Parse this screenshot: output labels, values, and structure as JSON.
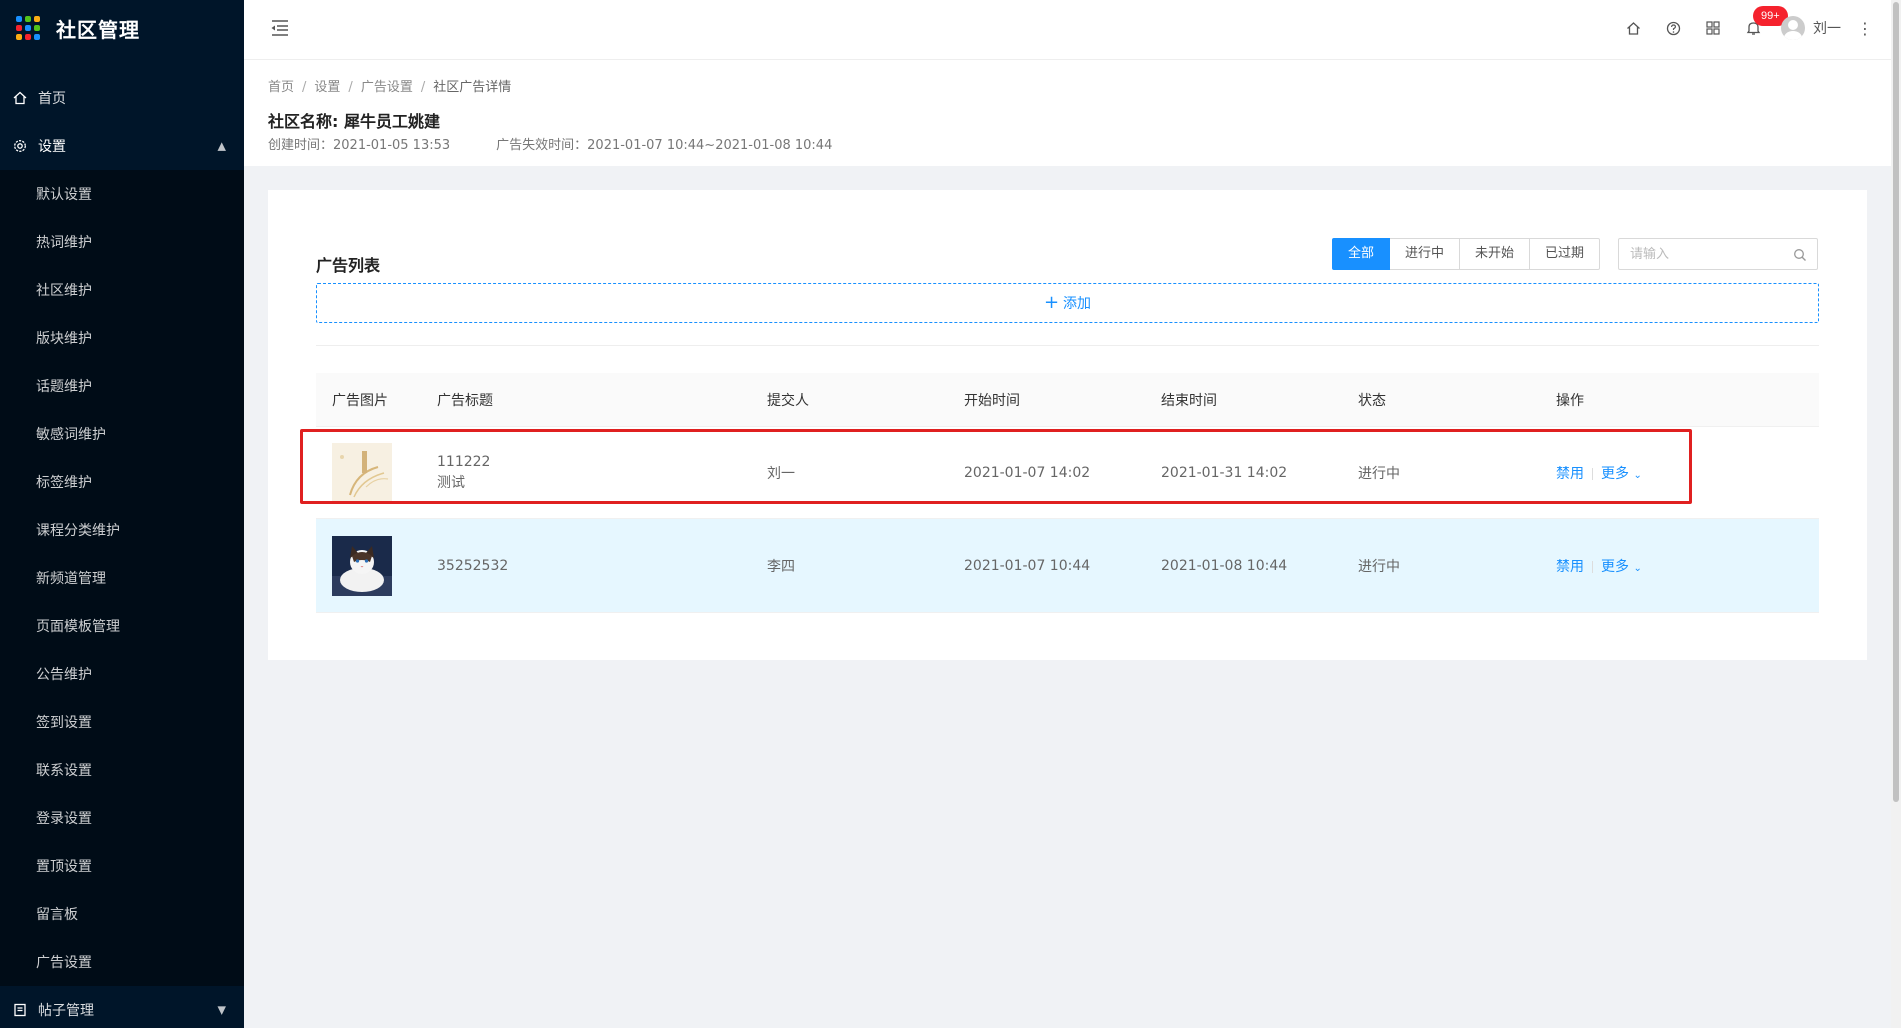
{
  "app": {
    "title": "社区管理"
  },
  "sidebar": {
    "home": "首页",
    "settings": "设置",
    "settings_items": [
      "默认设置",
      "热词维护",
      "社区维护",
      "版块维护",
      "话题维护",
      "敏感词维护",
      "标签维护",
      "课程分类维护",
      "新频道管理",
      "页面模板管理",
      "公告维护",
      "签到设置",
      "联系设置",
      "登录设置",
      "置顶设置",
      "留言板",
      "广告设置"
    ],
    "posts": "帖子管理"
  },
  "header": {
    "badge": "99+",
    "user_name": "刘一",
    "icons": [
      "menu-fold-icon",
      "home-icon",
      "question-icon",
      "grid-icon",
      "bell-icon",
      "more-icon"
    ]
  },
  "breadcrumb": [
    "首页",
    "设置",
    "广告设置",
    "社区广告详情"
  ],
  "page": {
    "title": "社区名称: 犀牛员工姚建",
    "created": "创建时间：2021-01-05 13:53",
    "expiry": "广告失效时间：2021-01-07 10:44~2021-01-08 10:44"
  },
  "card": {
    "title": "广告列表",
    "filters": [
      "全部",
      "进行中",
      "未开始",
      "已过期"
    ],
    "active_filter": "全部",
    "search_placeholder": "请输入",
    "add_label": "添加"
  },
  "table": {
    "columns": [
      "广告图片",
      "广告标题",
      "提交人",
      "开始时间",
      "结束时间",
      "状态",
      "操作"
    ],
    "rows": [
      {
        "title_line1": "111222",
        "title_line2": "测试",
        "submitter": "刘一",
        "start": "2021-01-07 14:02",
        "end": "2021-01-31 14:02",
        "status": "进行中",
        "op_disable": "禁用",
        "op_more": "更多"
      },
      {
        "title_line1": "35252532",
        "title_line2": "",
        "submitter": "李四",
        "start": "2021-01-07 10:44",
        "end": "2021-01-08 10:44",
        "status": "进行中",
        "op_disable": "禁用",
        "op_more": "更多"
      }
    ]
  },
  "colors": {
    "primary": "#1890ff",
    "sidebar_bg": "#001529",
    "highlight": "#e02020",
    "selected_row": "#e6f7ff"
  }
}
